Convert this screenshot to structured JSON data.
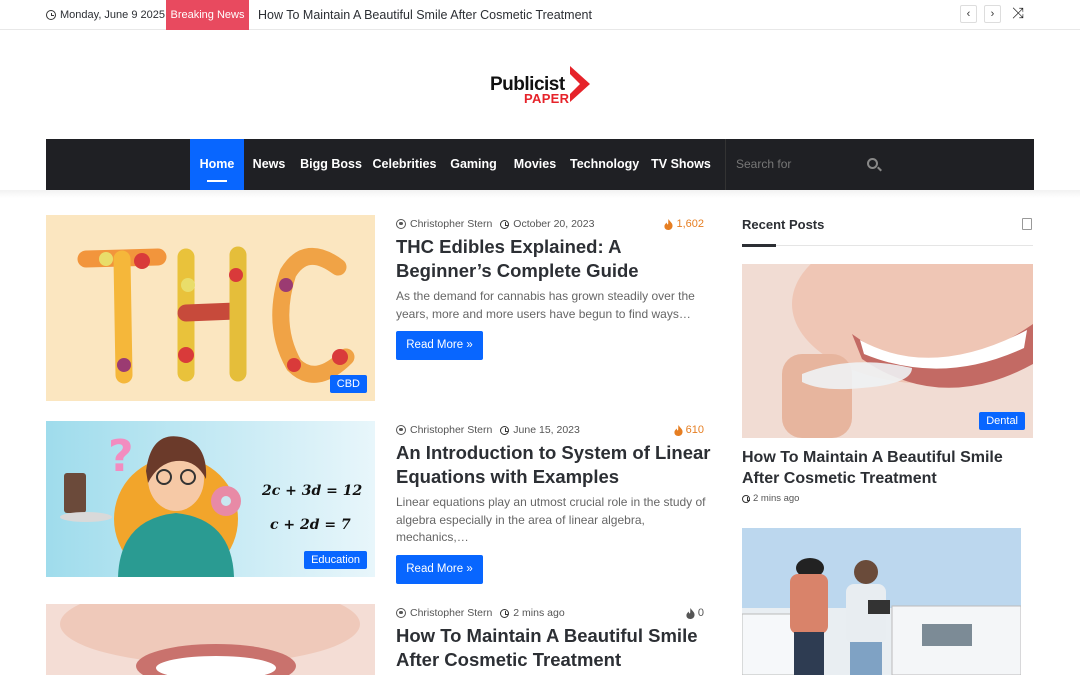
{
  "topbar": {
    "date": "Monday, June 9 2025",
    "breaking_label": "Breaking News",
    "ticker_text": "How To Maintain A Beautiful Smile After Cosmetic Treatment",
    "prev": "‹",
    "next": "›",
    "shuffle": "⤨"
  },
  "logo": {
    "line1": "Publicist",
    "line2": "PAPER"
  },
  "nav": {
    "items": [
      "Home",
      "News",
      "Bigg Boss",
      "Celebrities",
      "Gaming",
      "Movies",
      "Technology",
      "TV Shows"
    ],
    "search_placeholder": "Search for"
  },
  "posts": [
    {
      "author": "Christopher Stern",
      "date": "October 20, 2023",
      "views": "1,602",
      "title": "THC Edibles Explained: A Beginner’s Complete Guide",
      "excerpt": "As the demand for cannabis has grown steadily over the years, more and more users have begun to find ways…",
      "read_more": "Read More »",
      "category": "CBD",
      "image_text": "THC"
    },
    {
      "author": "Christopher Stern",
      "date": "June 15, 2023",
      "views": "610",
      "title": "An Introduction to System of Linear Equations with Examples",
      "excerpt": "Linear equations play an utmost crucial role in the study of algebra especially in the area of linear algebra, mechanics,…",
      "read_more": "Read More »",
      "category": "Education",
      "eq1": "2c + 3d = 12",
      "eq2": "c + 2d = 7"
    },
    {
      "author": "Christopher Stern",
      "date": "2 mins ago",
      "views": "0",
      "title": "How To Maintain A Beautiful Smile After Cosmetic Treatment"
    }
  ],
  "sidebar": {
    "title": "Recent Posts",
    "post_title": "How To Maintain A Beautiful Smile After Cosmetic Treatment",
    "post_time": "2 mins ago",
    "category": "Dental"
  },
  "colors": {
    "accent": "#0866ff",
    "breaking": "#e84a5f",
    "nav_bg": "#1f2024",
    "views": "#e67e22",
    "logo_red": "#e6232a"
  },
  "icons": [
    "clock-icon",
    "shuffle-icon",
    "user-icon",
    "fire-icon",
    "search-icon",
    "document-icon"
  ]
}
